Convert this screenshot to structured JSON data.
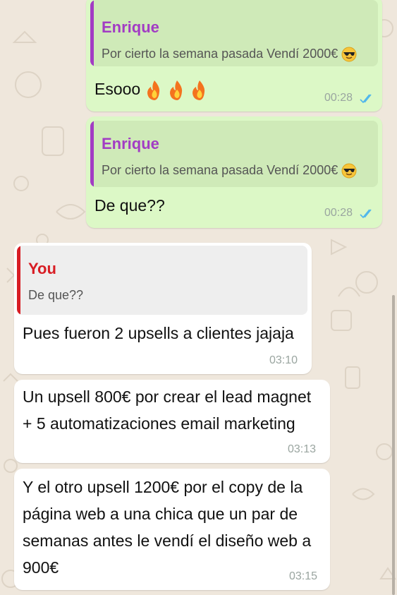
{
  "colors": {
    "outgoing_bubble": "#dcf8c6",
    "incoming_bubble": "#ffffff",
    "reply_name_purple": "#a23cc4",
    "reply_name_red": "#d81d24",
    "read_ticks": "#4fb6ec",
    "chat_background": "#efe7dc"
  },
  "messages": [
    {
      "reply_name": "Enrique",
      "reply_text": "Por cierto la semana pasada Vendí 2000€",
      "reply_emoji": "smiling-face-with-sunglasses-icon",
      "text": "Esooo",
      "text_emojis": [
        "fire-icon",
        "fire-icon",
        "fire-icon"
      ],
      "time": "00:28",
      "status": "read"
    },
    {
      "reply_name": "Enrique",
      "reply_text": "Por cierto la semana pasada Vendí 2000€",
      "reply_emoji": "smiling-face-with-sunglasses-icon",
      "text": "De que??",
      "time": "00:28",
      "status": "read"
    },
    {
      "reply_name": "You",
      "reply_text": "De que??",
      "text": "Pues fueron 2 upsells a clientes jajaja",
      "time": "03:10"
    },
    {
      "line1": "Un upsell 800€ por crear el lead magnet",
      "line2": "+ 5 automatizaciones email marketing",
      "time": "03:13"
    },
    {
      "line1": "Y el otro upsell 1200€ por el copy de la",
      "line2": "página web a una chica que un par de",
      "line3": "semanas antes le vendí el diseño web a",
      "line4": "900€",
      "time": "03:15"
    }
  ]
}
